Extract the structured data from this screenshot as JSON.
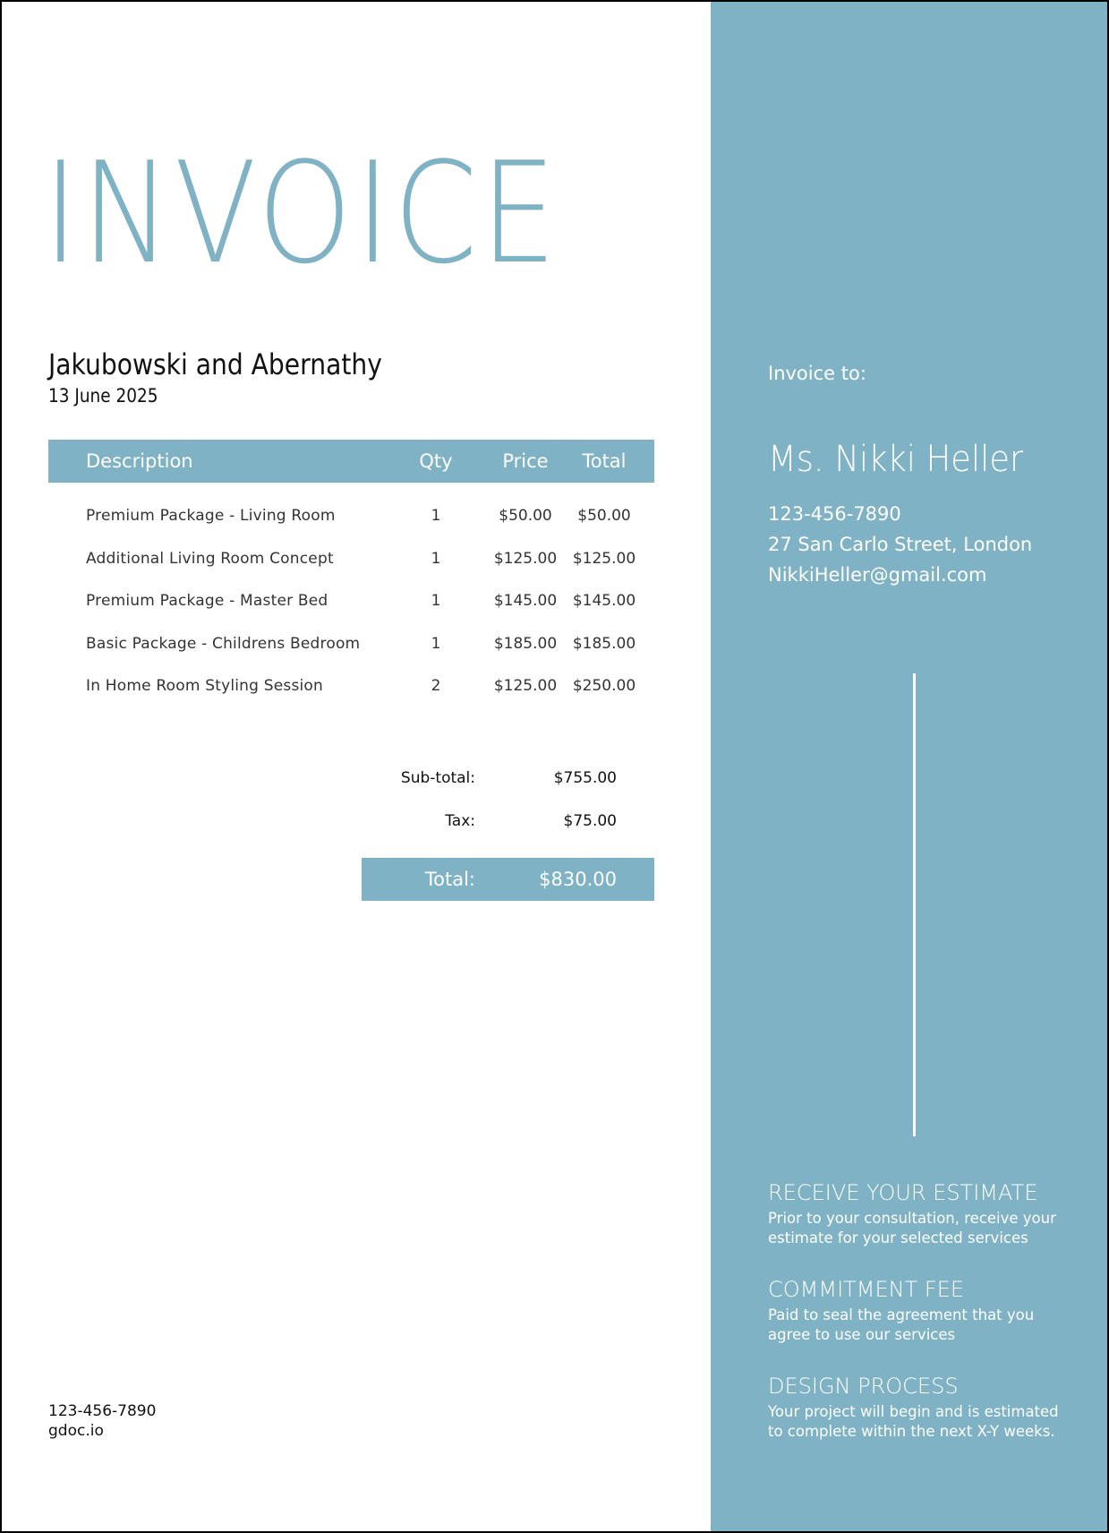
{
  "document": {
    "title": "INVOICE",
    "company": "Jakubowski and Abernathy",
    "date": "13 June 2025",
    "accent_color": "#7fb2c5"
  },
  "table": {
    "headers": {
      "description": "Description",
      "qty": "Qty",
      "price": "Price",
      "total": "Total"
    },
    "rows": [
      {
        "description": "Premium Package - Living Room",
        "qty": "1",
        "price": "$50.00",
        "total": "$50.00"
      },
      {
        "description": "Additional Living Room Concept",
        "qty": "1",
        "price": "$125.00",
        "total": "$125.00"
      },
      {
        "description": "Premium Package - Master Bed",
        "qty": "1",
        "price": "$145.00",
        "total": "$145.00"
      },
      {
        "description": "Basic Package - Childrens Bedroom",
        "qty": "1",
        "price": "$185.00",
        "total": "$185.00"
      },
      {
        "description": "In Home Room Styling Session",
        "qty": "2",
        "price": "$125.00",
        "total": "$250.00"
      }
    ]
  },
  "summary": {
    "subtotal_label": "Sub-total:",
    "subtotal_value": "$755.00",
    "tax_label": "Tax:",
    "tax_value": "$75.00",
    "total_label": "Total:",
    "total_value": "$830.00"
  },
  "footer": {
    "phone": "123-456-7890",
    "website": "gdoc.io"
  },
  "sidebar": {
    "invoice_to_label": "Invoice to:",
    "client_name": "Ms. Nikki Heller",
    "client_phone": "123-456-7890",
    "client_address": "27 San Carlo Street, London",
    "client_email": "NikkiHeller@gmail.com",
    "steps": [
      {
        "title": "RECEIVE YOUR ESTIMATE",
        "body": "Prior to your consultation, receive your estimate for your selected services"
      },
      {
        "title": "COMMITMENT FEE",
        "body": "Paid to seal the agreement that you agree to use our services"
      },
      {
        "title": "DESIGN PROCESS",
        "body": "Your project will begin and is estimated to complete within the next X-Y weeks."
      }
    ]
  }
}
